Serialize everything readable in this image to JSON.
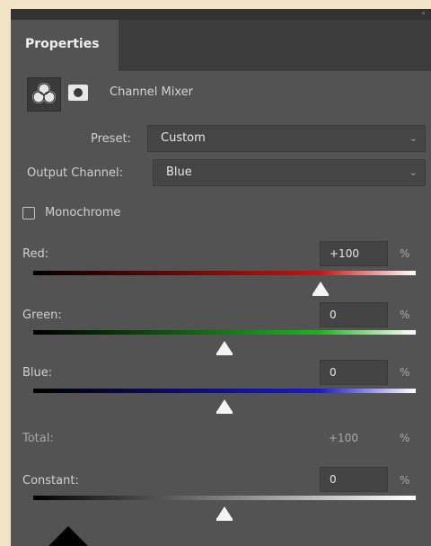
{
  "panel": {
    "tab_label": "Properties",
    "collapse_glyph": "«",
    "adjustment_title": "Channel Mixer",
    "adjustment_icon": "channel-mixer-icon",
    "mask_icon": "layer-mask-icon"
  },
  "preset": {
    "label": "Preset:",
    "value": "Custom"
  },
  "output_channel": {
    "label": "Output Channel:",
    "value": "Blue"
  },
  "monochrome": {
    "label": "Monochrome",
    "checked": false
  },
  "sliders": [
    {
      "label": "Red:",
      "value": "+100",
      "unit": "%",
      "min": -200,
      "max": 200,
      "numeric": 100,
      "gradient": [
        "#000000",
        "#c81414",
        "#ffffff"
      ]
    },
    {
      "label": "Green:",
      "value": "0",
      "unit": "%",
      "min": -200,
      "max": 200,
      "numeric": 0,
      "gradient": [
        "#000000",
        "#1fb41f",
        "#ffffff"
      ]
    },
    {
      "label": "Blue:",
      "value": "0",
      "unit": "%",
      "min": -200,
      "max": 200,
      "numeric": 0,
      "gradient": [
        "#000000",
        "#1a1ad0",
        "#ffffff"
      ]
    },
    {
      "label": "Constant:",
      "value": "0",
      "unit": "%",
      "min": -200,
      "max": 200,
      "numeric": 0,
      "gradient": [
        "#000000",
        "#808080",
        "#ffffff"
      ]
    }
  ],
  "total": {
    "label": "Total:",
    "value": "+100",
    "unit": "%"
  },
  "colors": {
    "panel_bg": "#535353",
    "page_bg": "#f3e3c6",
    "tab_bg": "#3c3c3c"
  }
}
